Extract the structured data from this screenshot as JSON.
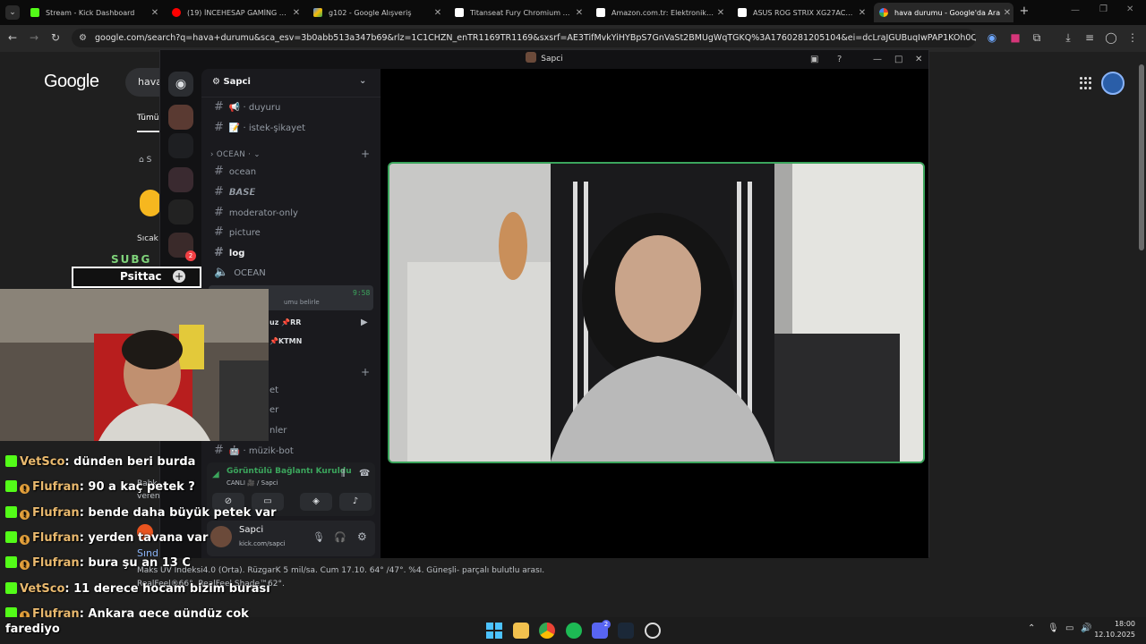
{
  "browser": {
    "tabs": [
      {
        "title": "Stream - Kick Dashboard",
        "active": false
      },
      {
        "title": "(19) İNCEHESAP GAMİNG GECE",
        "active": false
      },
      {
        "title": "g102 - Google Alışveriş",
        "active": false
      },
      {
        "title": "Titanseat Fury Chromium Kuma",
        "active": false
      },
      {
        "title": "Amazon.com.tr: Elektronik, bilg",
        "active": false
      },
      {
        "title": "ASUS ROG STRIX XG27ACS 27 |",
        "active": false
      },
      {
        "title": "hava durumu - Google'da Ara",
        "active": true
      }
    ],
    "url": "google.com/search?q=hava+durumu&sca_esv=3b0abb513a347b69&rlz=1C1CHZN_enTR1169TR1169&sxsrf=AE3TifMvkYiHYBpS7GnVaSt2BMUgWqTGKQ%3A1760281205104&ei=dcLraJGUBuqIwPAP1KOh0Q4&ved=0ahUKEwjRor2_...",
    "new_tab": "+"
  },
  "google": {
    "logo": "Google",
    "search_value": "hava",
    "tab_all": "Tümü",
    "hot_label": "Sıcak",
    "forecast_line": "Maks UV İndeksi4.0 (Orta). RüzgarK 5 mil/sa. Cum 17.10. 64° /47°. %4. Güneşli- parçalı bulutlu arası.",
    "realfeel_line": "RealFeel®66°. RealFeel Shade™62°.",
    "side_texts": [
      "Bahk",
      "veren",
      "Sınd"
    ]
  },
  "stream_overlay": {
    "sub_goal_label": "SUBG",
    "sub_goal_name": "Psittac",
    "chat": [
      {
        "user": "VetSco",
        "badge": false,
        "message": ": dünden beri burda"
      },
      {
        "user": "Flufran",
        "badge": true,
        "message": ": 90 a kaç petek ?"
      },
      {
        "user": "Flufran",
        "badge": true,
        "message": ": bende daha büyük petek var"
      },
      {
        "user": "Flufran",
        "badge": true,
        "message": ": yerden tavana var"
      },
      {
        "user": "Flufran",
        "badge": true,
        "message": ": bura şu an 13 C"
      },
      {
        "user": "VetSco",
        "badge": false,
        "message": ": 11 derece hocam bizim burası"
      },
      {
        "user": "Flufran",
        "badge": true,
        "message": ": Ankara gece gündüz çok"
      }
    ],
    "chat_continuation": "farediyo"
  },
  "discord": {
    "window_title": "Sapci",
    "server_name": "Sapci",
    "channels_top": [
      {
        "name": "📢 · duyuru"
      },
      {
        "name": "📝 · istek-şikayet"
      }
    ],
    "category": "OCEAN",
    "category_add": "+",
    "channels": [
      {
        "name": "ocean",
        "bright": false
      },
      {
        "name": "𝘽𝘼𝙎𝙀",
        "bright": false
      },
      {
        "name": "moderator-only",
        "bright": false
      },
      {
        "name": "picture",
        "bright": false
      },
      {
        "name": "log",
        "bright": true
      },
      {
        "name": "OCEAN",
        "bright": false
      }
    ],
    "voice_time": "9:58",
    "voice_status_hint": "umu belirle",
    "voice_members": [
      "uz 📌RR",
      "📌KTMN"
    ],
    "partial_channels": [
      "et",
      "er",
      "nler"
    ],
    "music_channel": "🤖 · müzik-bot",
    "voice_connected": "Görüntülü Bağlantı Kuruldu",
    "voice_live": "CANLI 🎥 / Sapci",
    "user_name": "Sapci",
    "user_status": "kick.com/sapci",
    "badge_count": "2"
  },
  "taskbar": {
    "time": "18:00",
    "date": "12.10.2025",
    "discord_badge": "2"
  },
  "colors": {
    "accent_green": "#3ba55c",
    "kick_green": "#53fc18",
    "chat_user": "#e9b96e"
  }
}
